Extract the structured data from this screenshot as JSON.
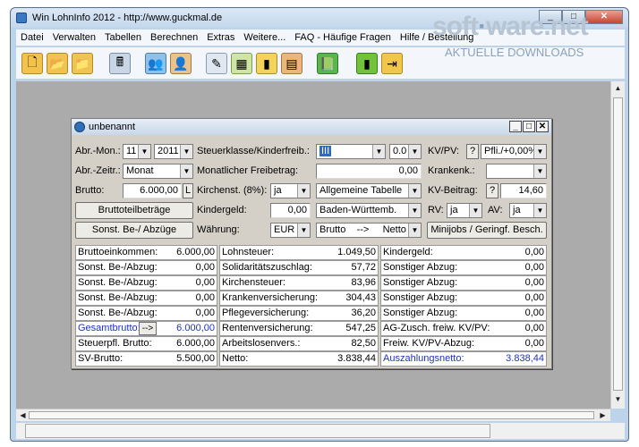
{
  "window": {
    "title": "Win LohnInfo 2012 - http://www.guckmal.de"
  },
  "menu": [
    "Datei",
    "Verwalten",
    "Tabellen",
    "Berechnen",
    "Extras",
    "Weitere...",
    "FAQ - Häufige Fragen",
    "Hilfe / Bestellung"
  ],
  "watermark": {
    "text_a": "soft",
    "text_b": "ware",
    "text_c": ".net",
    "sub": "AKTUELLE DOWNLOADS"
  },
  "toolbar_icons": [
    "new-doc-icon",
    "open-folder-icon",
    "folder-icon",
    "calculator-icon",
    "users-icon",
    "person-card-icon",
    "pencil-icon",
    "calendar-icon",
    "bar-chart-icon",
    "table-icon",
    "book-icon",
    "green-book-icon",
    "exit-icon"
  ],
  "child": {
    "title": "unbenannt",
    "labels": {
      "abr_mon": "Abr.-Mon.:",
      "abr_zeitr": "Abr.-Zeitr.:",
      "brutto": "Brutto:",
      "steuerklasse": "Steuerklasse/Kinderfreib.:",
      "freibetrag": "Monatlicher Freibetrag:",
      "kirchenst": "Kirchenst. (8%):",
      "kindergeld": "Kindergeld:",
      "waehrung": "Währung:",
      "kvpv": "KV/PV:",
      "krankenk": "Krankenk.:",
      "kv_beitrag": "KV-Beitrag:",
      "rv": "RV:",
      "av": "AV:"
    },
    "values": {
      "month": "11",
      "year": "2011",
      "zeitraum": "Monat",
      "brutto": "6.000,00",
      "brutto_l": "L",
      "steuerklasse": "III",
      "kinderfreib": "0.0",
      "freibetrag": "0,00",
      "kirchenst": "ja",
      "tabelle": "Allgemeine Tabelle",
      "kindergeld": "0,00",
      "bundesland": "Baden-Württemb.",
      "waehrung": "EUR",
      "brutto_netto": "Brutto    -->     Netto",
      "kvpv_q": "?",
      "kvpv": "Pfli./+0,00%",
      "krankenk": "",
      "kv_q": "?",
      "kv_beitrag": "14,60",
      "rv": "ja",
      "av": "ja"
    },
    "buttons": {
      "bruttoteil": "Bruttoteilbeträge",
      "sonst": "Sonst. Be-/ Abzüge",
      "minijobs": "Minijobs / Geringf. Besch."
    },
    "results": {
      "col1": [
        {
          "k": "Bruttoeinkommen:",
          "v": "6.000,00"
        },
        {
          "k": "Sonst. Be-/Abzug:",
          "v": "0,00"
        },
        {
          "k": "Sonst. Be-/Abzug:",
          "v": "0,00"
        },
        {
          "k": "Sonst. Be-/Abzug:",
          "v": "0,00"
        },
        {
          "k": "Sonst. Be-/Abzug:",
          "v": "0,00"
        },
        {
          "k": "Gesamtbrutto:",
          "v": "6.000,00"
        },
        {
          "k": "Steuerpfl. Brutto:",
          "v": "6.000,00"
        },
        {
          "k": "SV-Brutto:",
          "v": "5.500,00"
        }
      ],
      "gesamt_btn": "-->",
      "col2": [
        {
          "k": "Lohnsteuer:",
          "v": "1.049,50"
        },
        {
          "k": "Solidaritätszuschlag:",
          "v": "57,72"
        },
        {
          "k": "Kirchensteuer:",
          "v": "83,96"
        },
        {
          "k": "Krankenversicherung:",
          "v": "304,43"
        },
        {
          "k": "Pflegeversicherung:",
          "v": "36,20"
        },
        {
          "k": "Rentenversicherung:",
          "v": "547,25"
        },
        {
          "k": "Arbeitslosenvers.:",
          "v": "82,50"
        },
        {
          "k": "Netto:",
          "v": "3.838,44"
        }
      ],
      "col3": [
        {
          "k": "Kindergeld:",
          "v": "0,00"
        },
        {
          "k": "Sonstiger Abzug:",
          "v": "0,00"
        },
        {
          "k": "Sonstiger Abzug:",
          "v": "0,00"
        },
        {
          "k": "Sonstiger Abzug:",
          "v": "0,00"
        },
        {
          "k": "Sonstiger Abzug:",
          "v": "0,00"
        },
        {
          "k": "AG-Zusch. freiw. KV/PV:",
          "v": "0,00"
        },
        {
          "k": "Freiw. KV/PV-Abzug:",
          "v": "0,00"
        },
        {
          "k": "Auszahlungsnetto:",
          "v": "3.838,44"
        }
      ]
    }
  },
  "colors": {
    "accent_blue": "#1d32c8",
    "selection": "#316ac5"
  }
}
